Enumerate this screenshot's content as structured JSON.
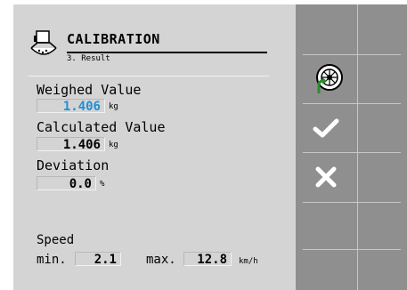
{
  "header": {
    "title": "CALIBRATION",
    "subtitle": "3. Result"
  },
  "weighed": {
    "label": "Weighed Value",
    "value": "1.406",
    "unit": "kg",
    "value_color": "#1f8fd6"
  },
  "calculated": {
    "label": "Calculated Value",
    "value": "1.406",
    "unit": "kg"
  },
  "deviation": {
    "label": "Deviation",
    "value": "0.0",
    "unit": "%"
  },
  "speed": {
    "label": "Speed",
    "min_label": "min.",
    "min_value": "2.1",
    "max_label": "max.",
    "max_value": "12.8",
    "unit": "km/h"
  },
  "softkeys": [
    {
      "icon": "empty"
    },
    {
      "icon": "rotate-wheel-icon"
    },
    {
      "icon": "check-icon"
    },
    {
      "icon": "close-icon"
    },
    {
      "icon": "empty"
    },
    {
      "icon": "empty"
    }
  ]
}
